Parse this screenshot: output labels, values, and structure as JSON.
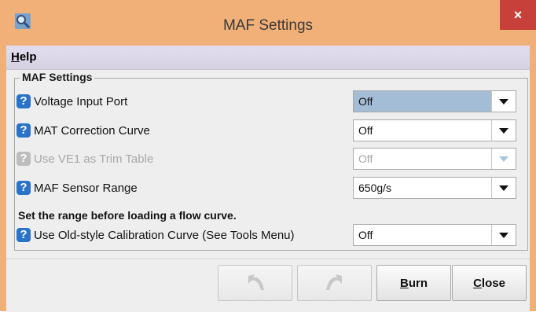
{
  "window": {
    "title": "MAF Settings",
    "app_icon": "magnifier-app-icon",
    "close_glyph": "×",
    "titlebar_color": "#f0b078",
    "close_color": "#c7413a"
  },
  "menubar": {
    "items": [
      {
        "label": "Help",
        "mnemonic": "H",
        "rest": "elp"
      }
    ]
  },
  "group": {
    "title": "MAF Settings",
    "help_glyph": "?",
    "rows": [
      {
        "label": "Voltage Input Port",
        "value": "Off",
        "enabled": true,
        "focused": true
      },
      {
        "label": "MAT Correction Curve",
        "value": "Off",
        "enabled": true,
        "focused": false
      },
      {
        "label": "Use VE1 as Trim Table",
        "value": "Off",
        "enabled": false,
        "focused": false
      },
      {
        "label": "MAF Sensor Range",
        "value": "650g/s",
        "enabled": true,
        "focused": false
      }
    ],
    "note": "Set the range before loading a flow curve.",
    "last_row": {
      "label": "Use Old-style Calibration Curve (See Tools Menu)",
      "value": "Off",
      "enabled": true
    }
  },
  "buttons": {
    "undo": {
      "icon": "undo-icon",
      "enabled": false
    },
    "redo": {
      "icon": "redo-icon",
      "enabled": false
    },
    "burn": {
      "label": "Burn",
      "mnemonic": "B",
      "rest": "urn"
    },
    "close": {
      "label": "Close",
      "mnemonic": "C",
      "rest": "lose"
    }
  },
  "colors": {
    "help_icon": "#2a73c9",
    "focused_select": "#a3bdd6"
  }
}
